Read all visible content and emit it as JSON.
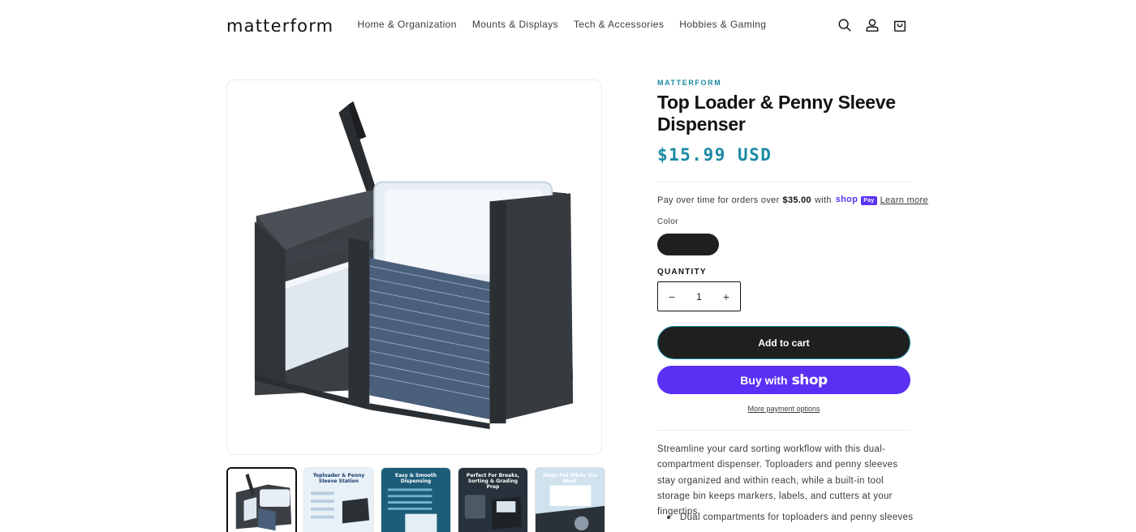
{
  "header": {
    "logo": "matterform",
    "nav": [
      {
        "label": "Home & Organization"
      },
      {
        "label": "Mounts & Displays"
      },
      {
        "label": "Tech & Accessories"
      },
      {
        "label": "Hobbies & Gaming"
      }
    ],
    "icons": [
      "search-icon",
      "account-icon",
      "cart-icon"
    ]
  },
  "product": {
    "vendor": "MATTERFORM",
    "title": "Top Loader & Penny Sleeve Dispenser",
    "price": "$15.99 USD",
    "installments": {
      "prefix": "Pay over time for orders over",
      "amount": "$35.00",
      "with": "with",
      "shop_pay_badge": "Pay",
      "shop_word": "shop",
      "learn_more": "Learn more"
    },
    "color_label": "Color",
    "color_swatch": "#1f1f1f",
    "quantity_label": "QUANTITY",
    "quantity_value": "1",
    "minus_glyph": "−",
    "plus_glyph": "+",
    "add_to_cart": "Add to cart",
    "buy_with": "Buy with",
    "buy_shop_word": "shop",
    "more_payment": "More payment options",
    "description": "Streamline your card sorting workflow with this dual-compartment dispenser. Toploaders and penny sleeves stay organized and within reach, while a built-in tool storage bin keeps markers, labels, and cutters at your fingertips.",
    "bullets": [
      "Dual compartments for toploaders and penny sleeves"
    ]
  },
  "thumbnails": [
    {
      "caption": ""
    },
    {
      "caption": "Toploader & Penny Sleeve Station"
    },
    {
      "caption": "Easy & Smooth Dispensing"
    },
    {
      "caption": "Perfect For Breaks, Sorting & Grading Prep"
    },
    {
      "caption": "Stays Put While You Work"
    }
  ],
  "colors": {
    "accent": "#1a8aa3",
    "shop_pay": "#5a31f4",
    "button_dark": "#1f1f1f"
  }
}
